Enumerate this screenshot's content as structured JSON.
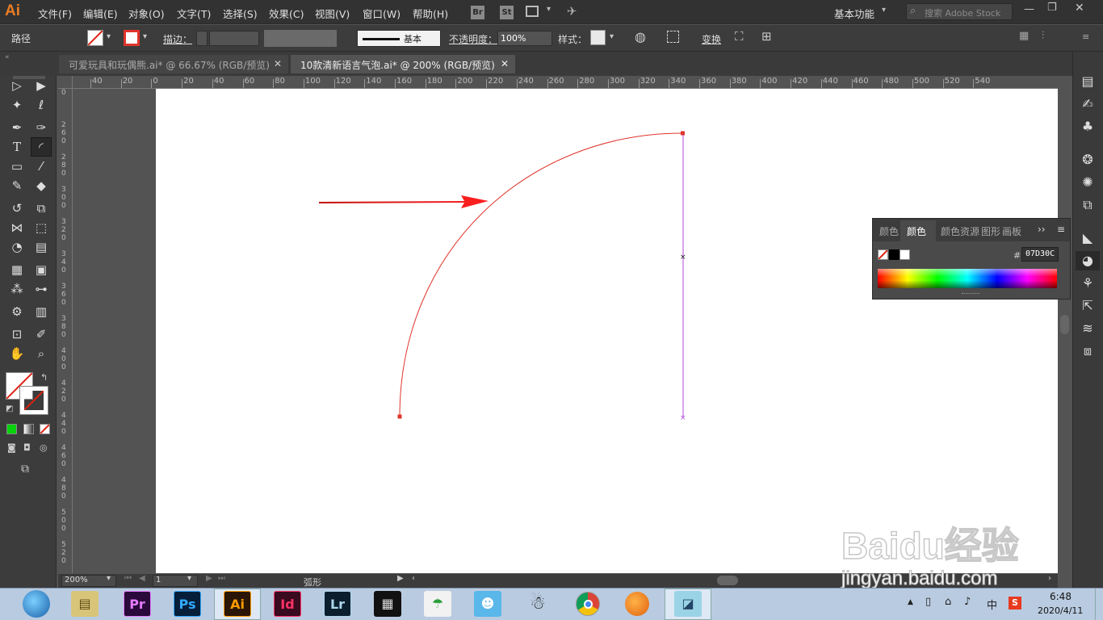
{
  "app": {
    "logo": "Ai"
  },
  "menu": [
    "文件(F)",
    "编辑(E)",
    "对象(O)",
    "文字(T)",
    "选择(S)",
    "效果(C)",
    "视图(V)",
    "窗口(W)",
    "帮助(H)"
  ],
  "menubar_right": {
    "bridge": "Br",
    "stock": "St",
    "workspace": "基本功能",
    "search_placeholder": "搜索 Adobe Stock"
  },
  "control": {
    "object_type": "路径",
    "stroke_label": "描边：",
    "stroke_profile": "基本",
    "opacity_label": "不透明度：",
    "opacity_value": "100%",
    "style_label": "样式：",
    "transform_label": "变换"
  },
  "tabs": [
    {
      "label": "可爱玩具和玩偶熊.ai* @ 66.67% (RGB/预览)",
      "active": false
    },
    {
      "label": "10款清新语言气泡.ai* @ 200% (RGB/预览)",
      "active": true
    }
  ],
  "ruler": {
    "h_ticks": [
      "40",
      "20",
      "0",
      "20",
      "40",
      "60",
      "80",
      "100",
      "120",
      "140",
      "160",
      "180",
      "200",
      "220",
      "240",
      "260",
      "280",
      "300",
      "320",
      "340",
      "360",
      "380",
      "400",
      "420",
      "440",
      "460",
      "480",
      "500",
      "520",
      "540"
    ],
    "v_ticks": [
      "0",
      "2 6 0",
      "2 8 0",
      "3 0 0",
      "3 2 0",
      "3 4 0",
      "3 6 0",
      "3 8 0",
      "4 0 0",
      "4 2 0",
      "4 4 0",
      "4 6 0",
      "4 8 0",
      "5 0 0",
      "5 2 0"
    ]
  },
  "color_panel": {
    "tabs": [
      "颜色",
      "颜色",
      "颜色",
      "资源",
      "图形",
      "画板"
    ],
    "hex_label": "#",
    "hex_value": "07D30C"
  },
  "status": {
    "zoom": "200%",
    "artboard": "1",
    "tool_name": "弧形"
  },
  "taskbar": {
    "apps": [
      "Pr",
      "Ps",
      "Ai",
      "Id",
      "Lr"
    ],
    "ime": "中",
    "time": "6:48",
    "date": "2020/4/11"
  },
  "watermark": {
    "brand": "Baidu经验",
    "url": "jingyan.baidu.com"
  },
  "colors": {
    "accent_ai": "#e97d24",
    "path_red": "#e0342c",
    "path_purple": "#b049d8"
  }
}
